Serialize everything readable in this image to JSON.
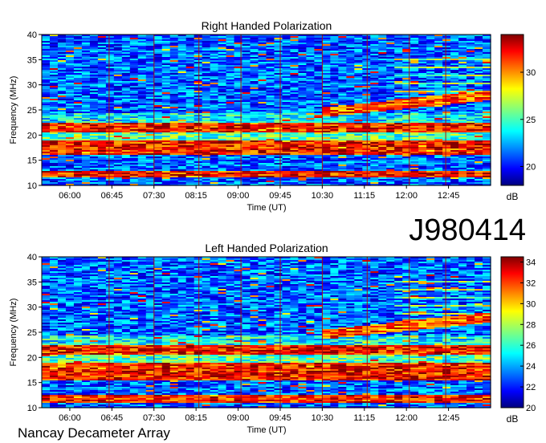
{
  "figure": {
    "id_label": "J980414",
    "footer": "Nancay Decameter Array"
  },
  "chart_data": [
    {
      "type": "heatmap",
      "title": "Right Handed Polarization",
      "xlabel": "Time (UT)",
      "ylabel": "Frequency (MHz)",
      "x_ticks": [
        "06:00",
        "06:45",
        "07:30",
        "08:15",
        "09:00",
        "09:45",
        "10:30",
        "11:15",
        "12:00",
        "12:45"
      ],
      "x_tick_hours": [
        6.0,
        6.75,
        7.5,
        8.25,
        9.0,
        9.75,
        10.5,
        11.25,
        12.0,
        12.75
      ],
      "xlim_hours": [
        5.5,
        13.5
      ],
      "y_ticks": [
        10,
        15,
        20,
        25,
        30,
        35,
        40
      ],
      "ylim": [
        10,
        40
      ],
      "colorbar": {
        "label": "dB",
        "ticks": [
          20,
          25,
          30
        ],
        "range": [
          18,
          34
        ]
      },
      "strong_emission_bands_mhz": [
        [
          11.5,
          13
        ],
        [
          16,
          19
        ],
        [
          20.5,
          22.5
        ]
      ],
      "rising_band": {
        "start_freq": 24.5,
        "end_freq": 28,
        "start_hour": 10.5,
        "end_hour": 13.5
      },
      "vertical_markers_hours": [
        6.7,
        7.5,
        8.3,
        9.05,
        9.75,
        10.5,
        11.3,
        12.05,
        12.7
      ]
    },
    {
      "type": "heatmap",
      "title": "Left Handed Polarization",
      "xlabel": "Time (UT)",
      "ylabel": "Frequency (MHz)",
      "x_ticks": [
        "06:00",
        "06:45",
        "07:30",
        "08:15",
        "09:00",
        "09:45",
        "10:30",
        "11:15",
        "12:00",
        "12:45"
      ],
      "x_tick_hours": [
        6.0,
        6.75,
        7.5,
        8.25,
        9.0,
        9.75,
        10.5,
        11.25,
        12.0,
        12.75
      ],
      "xlim_hours": [
        5.5,
        13.5
      ],
      "y_ticks": [
        10,
        15,
        20,
        25,
        30,
        35,
        40
      ],
      "ylim": [
        10,
        40
      ],
      "colorbar": {
        "label": "dB",
        "ticks": [
          20,
          22,
          24,
          26,
          28,
          30,
          32,
          34
        ],
        "range": [
          20,
          34.5
        ]
      },
      "strong_emission_bands_mhz": [
        [
          11,
          12.5
        ],
        [
          15.5,
          19
        ],
        [
          20,
          22.5
        ]
      ],
      "rising_band": {
        "start_freq": 24.5,
        "end_freq": 28,
        "start_hour": 10.5,
        "end_hour": 13.5
      },
      "vertical_markers_hours": [
        6.7,
        7.5,
        8.3,
        9.05,
        9.75,
        10.5,
        11.3,
        12.05,
        12.7
      ]
    }
  ]
}
